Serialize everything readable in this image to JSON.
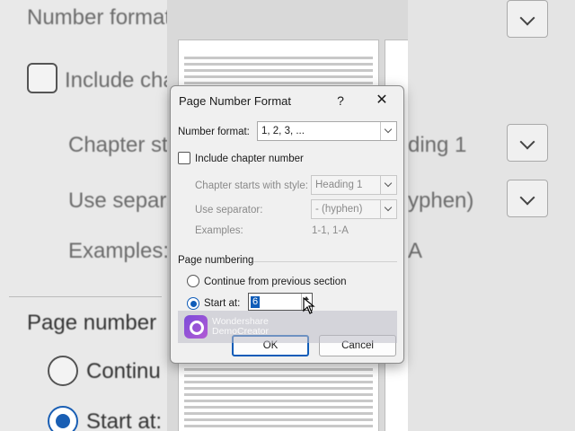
{
  "background_left": {
    "number_format_label": "Number format",
    "include_chapter_label": "Include chapter",
    "chapter_starts_label": "Chapter st",
    "use_separator_label": "Use separat",
    "examples_label": "Examples:",
    "page_numbering_label": "Page number",
    "continue_label": "Continu",
    "start_at_label": "Start at:"
  },
  "background_right": {
    "heading_value": "ding 1",
    "separator_value": "yphen)",
    "example_value": "A"
  },
  "dialog": {
    "title": "Page Number Format",
    "help_icon": "?",
    "close_icon": "✕",
    "number_format": {
      "label": "Number format:",
      "value": "1, 2, 3, ..."
    },
    "include_chapter": {
      "label": "Include chapter number",
      "checked": false
    },
    "chapter_style": {
      "label": "Chapter starts with style:",
      "value": "Heading 1"
    },
    "separator": {
      "label": "Use separator:",
      "value": "-   (hyphen)"
    },
    "examples": {
      "label": "Examples:",
      "value": "1-1, 1-A"
    },
    "page_numbering": {
      "label": "Page numbering",
      "continue_label": "Continue from previous section",
      "start_at_label": "Start at:",
      "start_at_value": "6",
      "selected": "start_at"
    },
    "ok_label": "OK",
    "cancel_label": "Cancel"
  },
  "watermark": {
    "line1": "Wondershare",
    "line2": "DemoCreator"
  },
  "colors": {
    "accent": "#0f5cb8",
    "watermark_logo": "#8e4fd8"
  }
}
